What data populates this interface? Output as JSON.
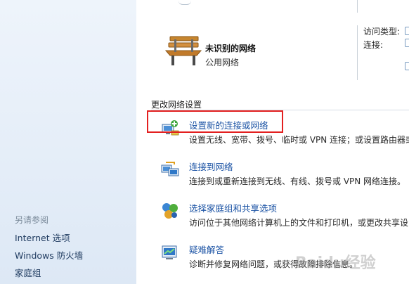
{
  "sidebar": {
    "see_also_title": "另请参阅",
    "links": [
      "Internet 选项",
      "Windows 防火墙",
      "家庭组"
    ]
  },
  "network": {
    "name": "未识别的网络",
    "type": "公用网络",
    "access_type_label": "访问类型:",
    "connection_label": "连接:"
  },
  "section": {
    "title": "更改网络设置"
  },
  "tasks": [
    {
      "link": "设置新的连接或网络",
      "desc": "设置无线、宽带、拨号、临时或 VPN 连接；或设置路由器或",
      "icon": "new-connection-icon"
    },
    {
      "link": "连接到网络",
      "desc": "连接到或重新连接到无线、有线、拨号或 VPN 网络连接。",
      "icon": "connect-network-icon"
    },
    {
      "link": "选择家庭组和共享选项",
      "desc": "访问位于其他网络计算机上的文件和打印机，或更改共享设",
      "icon": "homegroup-icon"
    },
    {
      "link": "疑难解答",
      "desc": "诊断并修复网络问题，或获得故障排除信息。",
      "icon": "troubleshoot-icon"
    }
  ],
  "watermark": "Baidu经验",
  "colors": {
    "link": "#1a52a4",
    "highlight": "#e32020",
    "sidebar_bg": "#e4edf8"
  }
}
